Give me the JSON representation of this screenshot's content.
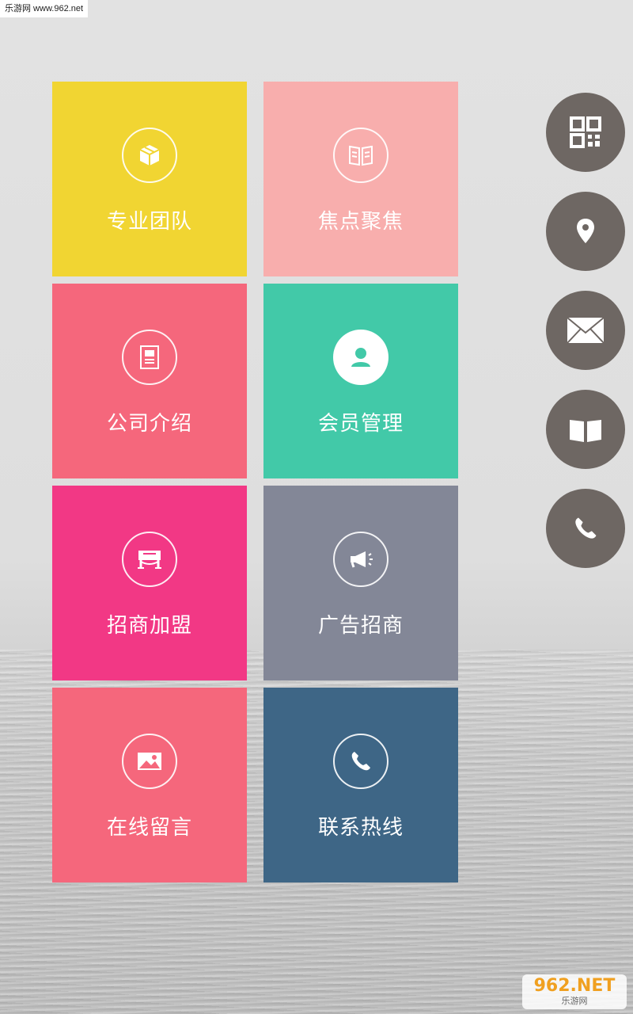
{
  "watermark": {
    "top_text": "乐游网 www.962.net",
    "bottom_big": "962.NET",
    "bottom_small": "乐游网"
  },
  "tiles": [
    {
      "label": "专业团队",
      "color": "#f1d532",
      "icon": "box-icon"
    },
    {
      "label": "焦点聚焦",
      "color": "#f8aead",
      "icon": "book-icon"
    },
    {
      "label": "公司介绍",
      "color": "#f5677c",
      "icon": "document-icon"
    },
    {
      "label": "会员管理",
      "color": "#42c9a8",
      "icon": "user-icon"
    },
    {
      "label": "招商加盟",
      "color": "#f23885",
      "icon": "storefront-icon"
    },
    {
      "label": "广告招商",
      "color": "#838797",
      "icon": "megaphone-icon"
    },
    {
      "label": "在线留言",
      "color": "#f5677c",
      "icon": "image-icon"
    },
    {
      "label": "联系热线",
      "color": "#3e6686",
      "icon": "phone-icon"
    }
  ],
  "side_buttons": [
    {
      "icon": "qr-code-icon"
    },
    {
      "icon": "location-pin-icon"
    },
    {
      "icon": "mail-icon"
    },
    {
      "icon": "book-icon"
    },
    {
      "icon": "phone-icon"
    }
  ],
  "colors": {
    "side_button_bg": "#6e6763"
  }
}
